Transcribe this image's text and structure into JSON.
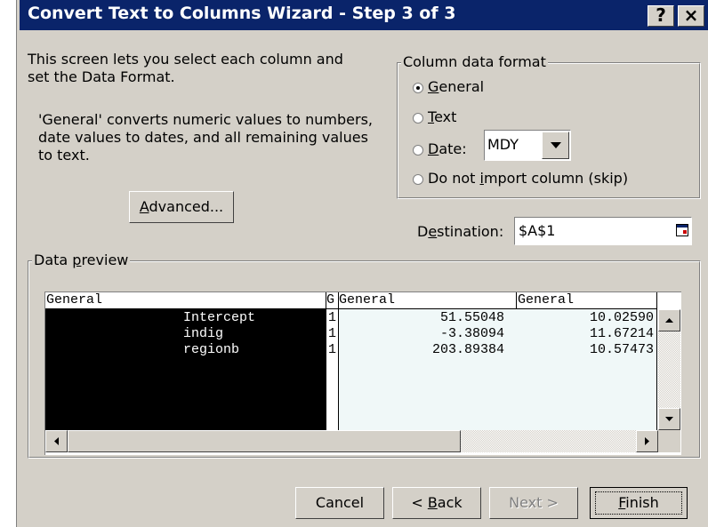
{
  "window": {
    "title": "Convert Text to Columns Wizard - Step 3 of 3",
    "help_glyph": "?",
    "close_glyph": "×"
  },
  "intro": {
    "line1": "This screen lets you select each column and",
    "line2": "set the Data Format."
  },
  "general_note": {
    "line1": "'General' converts numeric values to numbers,",
    "line2": "date values to dates, and all remaining values",
    "line3": "to text."
  },
  "advanced_button": {
    "pre": "",
    "key": "A",
    "post": "dvanced..."
  },
  "format_group": {
    "legend": "Column data format",
    "options": [
      {
        "pre": "",
        "key": "G",
        "post": "eneral",
        "selected": true
      },
      {
        "pre": "",
        "key": "T",
        "post": "ext",
        "selected": false
      },
      {
        "pre": "",
        "key": "D",
        "post": "ate:",
        "selected": false
      },
      {
        "pre": "Do not ",
        "key": "i",
        "post": "mport column (skip)",
        "selected": false
      }
    ],
    "date_format": "MDY"
  },
  "destination": {
    "label_pre": "D",
    "label_key": "e",
    "label_post": "stination:",
    "value": "$A$1"
  },
  "preview": {
    "legend_pre": "Data ",
    "legend_key": "p",
    "legend_post": "review",
    "headers": [
      "General",
      "G",
      "General",
      "General"
    ],
    "rows": [
      [
        "Intercept",
        "1",
        "51.55048",
        "10.02590"
      ],
      [
        "indig",
        "1",
        "-3.38094",
        "11.67214"
      ],
      [
        "regionb",
        "1",
        "203.89384",
        "10.57473"
      ]
    ]
  },
  "buttons": {
    "cancel": "Cancel",
    "back_pre": "< ",
    "back_key": "B",
    "back_post": "ack",
    "next": "Next >",
    "finish_pre": "",
    "finish_key": "F",
    "finish_post": "inish"
  },
  "colors": {
    "title_bar": "#0a246a",
    "face": "#d4d0c8",
    "selected_column": "#000000",
    "preview_bg": "#ffffff"
  }
}
